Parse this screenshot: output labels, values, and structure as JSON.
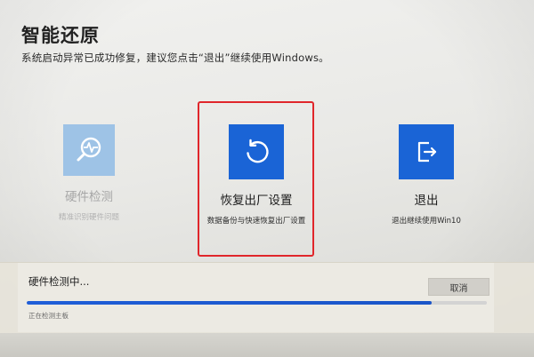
{
  "page": {
    "title": "智能还原",
    "subtitle": "系统启动异常已成功修复，建议您点击“退出”继续使用Windows。"
  },
  "options": {
    "hardware_check": {
      "label": "硬件检测",
      "desc": "精准识别硬件问题",
      "icon": "hardware-scan-icon",
      "color": "#9ec3e6"
    },
    "factory_reset": {
      "label": "恢复出厂设置",
      "desc": "数据备份与快速恢复出厂设置",
      "icon": "restore-icon",
      "color": "#1a64d6"
    },
    "exit": {
      "label": "退出",
      "desc": "退出继续使用Win10",
      "icon": "exit-icon",
      "color": "#1a64d6"
    }
  },
  "highlight_color": "#e0262b",
  "progress": {
    "title": "硬件检测中...",
    "cancel_label": "取消",
    "status": "正在检测主板",
    "percent": 88
  }
}
